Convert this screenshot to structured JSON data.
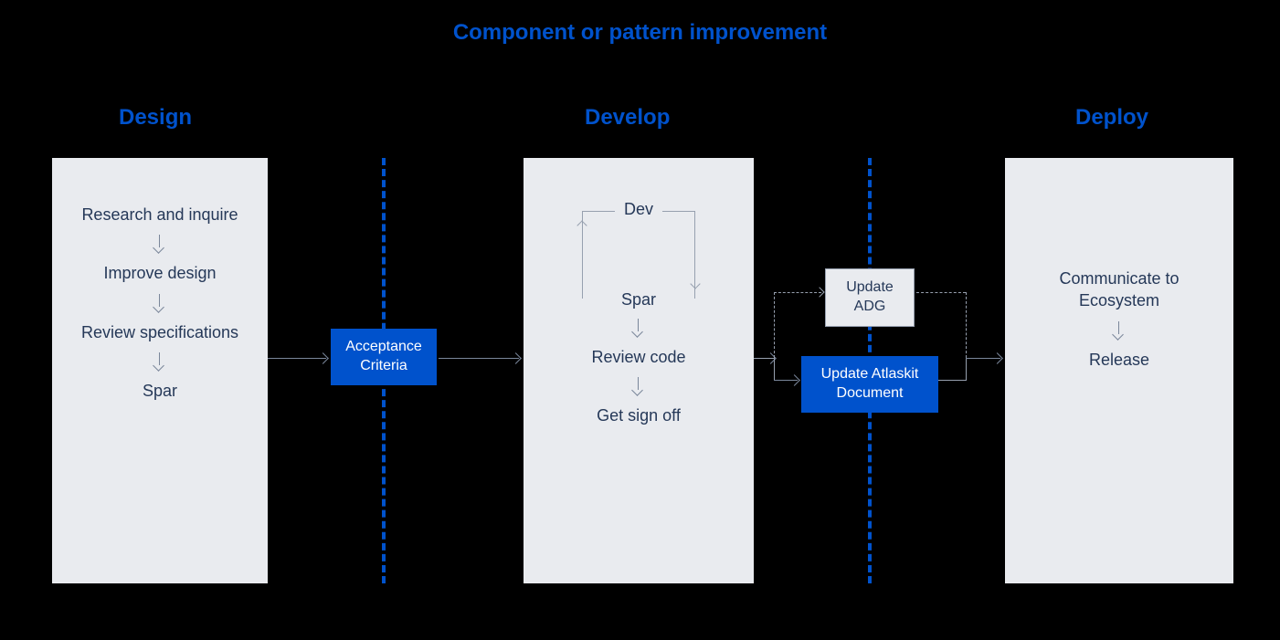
{
  "title": "Component or pattern improvement",
  "phases": {
    "design": "Design",
    "develop": "Develop",
    "deploy": "Deploy"
  },
  "design": {
    "step1": "Research and inquire",
    "step2": "Improve design",
    "step3": "Review specifications",
    "step4": "Spar"
  },
  "develop": {
    "loop_top": "Dev",
    "loop_bottom": "Spar",
    "step2": "Review code",
    "step3": "Get sign off"
  },
  "deploy": {
    "step1": "Communicate to Ecosystem",
    "step2": "Release"
  },
  "gates": {
    "acceptance": "Acceptance Criteria",
    "update_adg": "Update ADG",
    "update_atlaskit": "Update Atlaskit Document"
  }
}
